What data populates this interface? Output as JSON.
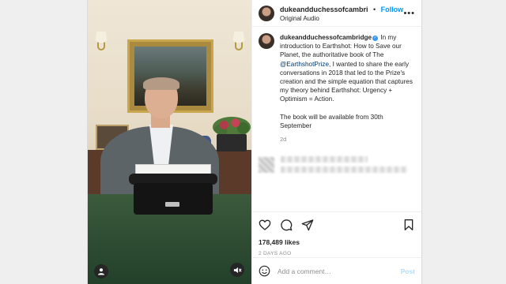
{
  "post": {
    "username": "dukeandduchessofcambri",
    "follow_label": "Follow",
    "separator": "•",
    "audio_label": "Original Audio",
    "more_label": "•••"
  },
  "caption": {
    "username": "dukeandduchessofcambridge",
    "text_before_mention": " In my introduction to Earthshot: How to Save our Planet, the authoritative book of The ",
    "mention": "@EarthshotPrize",
    "text_after_mention": ", I wanted to share the early conversations in 2018 that led to the Prize's creation and the simple equation that captures my theory behind Earthshot: Urgency + Optimism = Action.",
    "second_paragraph": "The book will be available from 30th September",
    "time": "2d"
  },
  "engagement": {
    "likes": "178,489 likes",
    "posted": "2 DAYS AGO"
  },
  "add_comment": {
    "placeholder": "Add a comment…",
    "post_label": "Post"
  },
  "icons": {
    "heart": "heart-icon",
    "comment": "comment-icon",
    "share": "share-icon",
    "save": "bookmark-icon",
    "emoji": "emoji-icon",
    "profile": "user-tag-icon",
    "mute": "muted-speaker-icon"
  },
  "colors": {
    "follow": "#0095f6",
    "text": "#262626",
    "muted": "#8e8e8e",
    "post_disabled": "#b2dffc",
    "verified": "#3897f0"
  }
}
